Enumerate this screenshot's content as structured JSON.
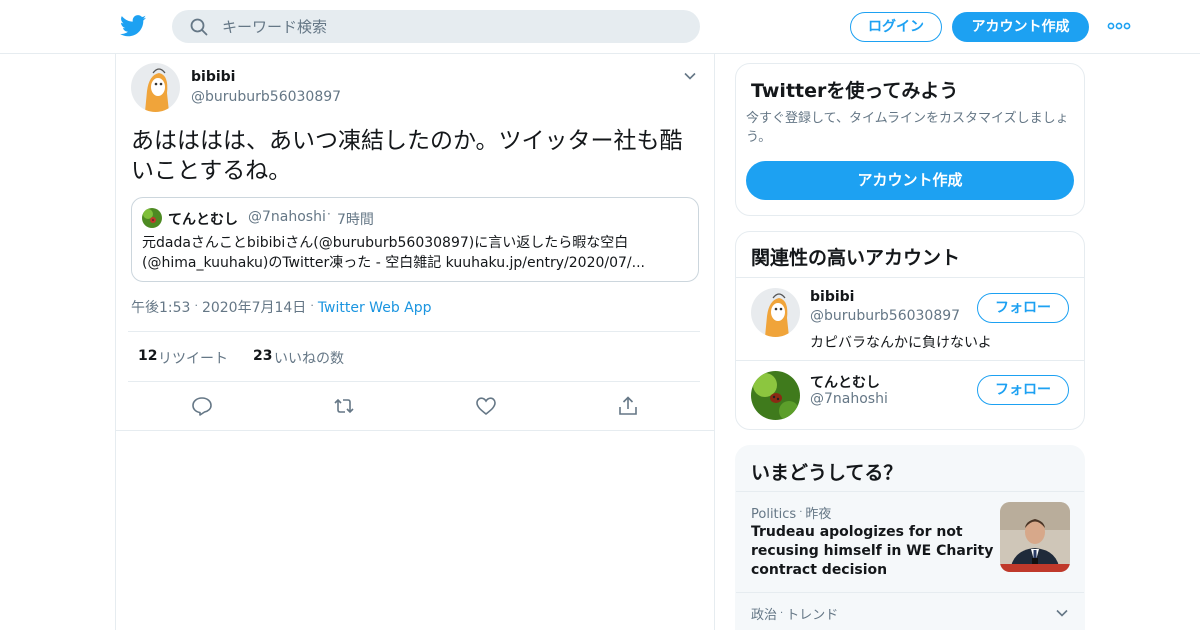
{
  "header": {
    "search_placeholder": "キーワード検索",
    "login_label": "ログイン",
    "signup_label": "アカウント作成"
  },
  "tweet": {
    "name": "bibibi",
    "handle": "@buruburb56030897",
    "text": "あはははは、あいつ凍結したのか。ツイッター社も酷いことするね。",
    "quote": {
      "name": "てんとむし",
      "handle": "@7nahoshi",
      "time": "7時間",
      "text": "元dadaさんことbibibiさん(@buruburb56030897)に言い返したら暇な空白(@hima_kuuhaku)のTwitter凍った - 空白雑記 kuuhaku.jp/entry/2020/07/..."
    },
    "time": "午後1:53",
    "date": "2020年7月14日",
    "via": "Twitter Web App",
    "retweet_count": "12",
    "retweet_label": "リツイート",
    "like_count": "23",
    "like_label": "いいねの数"
  },
  "signup_card": {
    "title": "Twitterを使ってみよう",
    "subtitle": "今すぐ登録して、タイムラインをカスタマイズしましょう。",
    "button": "アカウント作成"
  },
  "related": {
    "title": "関連性の高いアカウント",
    "accounts": [
      {
        "name": "bibibi",
        "handle": "@buruburb56030897",
        "bio": "カピバラなんかに負けないよ",
        "follow": "フォロー"
      },
      {
        "name": "てんとむし",
        "handle": "@7nahoshi",
        "bio": "",
        "follow": "フォロー"
      }
    ]
  },
  "trends": {
    "title": "いまどうしてる？",
    "items": [
      {
        "category": "Politics",
        "when": "昨夜",
        "title": "Trudeau apologizes for not recusing himself in WE Charity contract decision"
      },
      {
        "category": "政治",
        "when": "トレンド",
        "title": ""
      }
    ]
  },
  "colors": {
    "accent": "#1da1f2",
    "text": "#14171a",
    "muted": "#657786",
    "border": "#e6ecf0"
  }
}
